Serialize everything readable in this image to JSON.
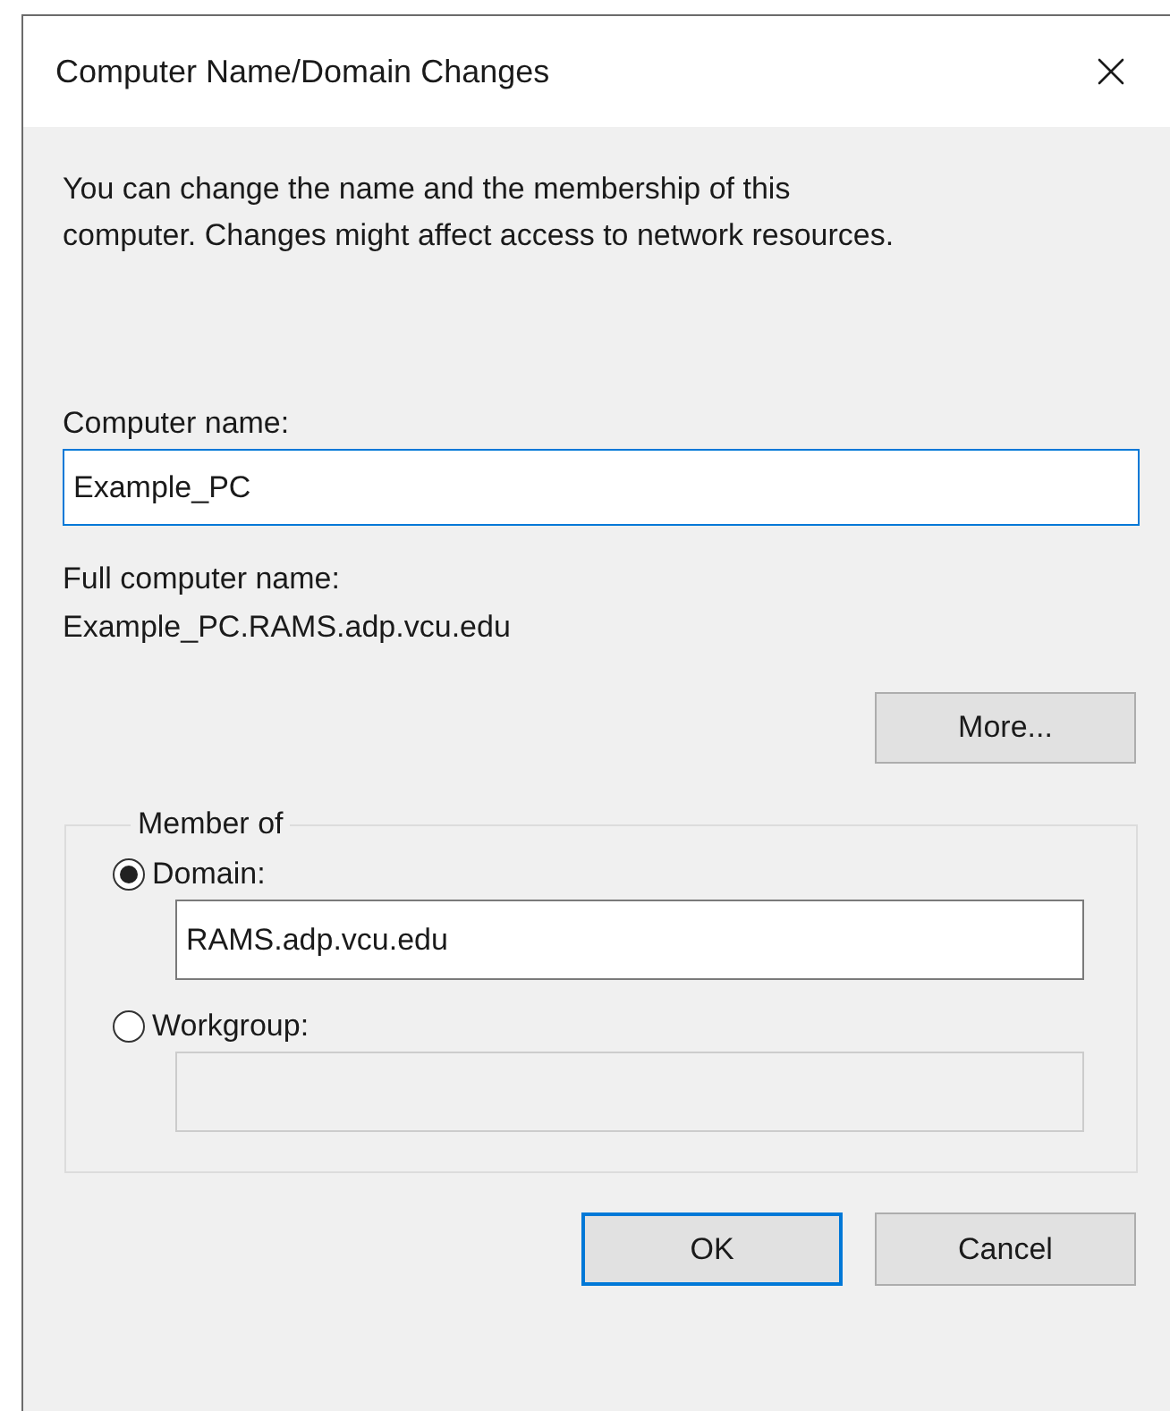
{
  "window": {
    "title": "Computer Name/Domain Changes"
  },
  "description": [
    "You can change the name and the membership of this",
    "computer. Changes might affect access to network resources."
  ],
  "computer_name": {
    "label": "Computer name:",
    "value": "Example_PC",
    "focused": true
  },
  "full_name": {
    "label": "Full computer name:",
    "value": "Example_PC.RAMS.adp.vcu.edu"
  },
  "more_button": {
    "label": "More..."
  },
  "member_of": {
    "legend": "Member of",
    "options": [
      {
        "label": "Domain:",
        "selected": true,
        "field": {
          "value": "RAMS.adp.vcu.edu",
          "disabled": false
        }
      },
      {
        "label": "Workgroup:",
        "selected": false,
        "field": {
          "disabled": true
        }
      }
    ]
  },
  "buttons": [
    {
      "label": "OK",
      "default": true
    },
    {
      "label": "Cancel",
      "default": false
    }
  ]
}
